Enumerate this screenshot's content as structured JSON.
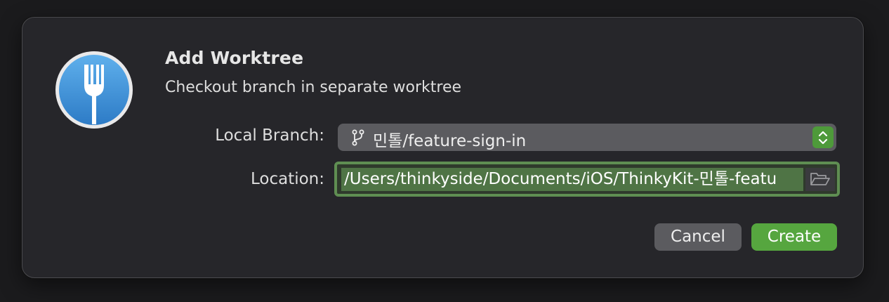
{
  "dialog": {
    "title": "Add Worktree",
    "subtitle": "Checkout branch in separate worktree",
    "app_icon": "fork-icon"
  },
  "form": {
    "branch_label": "Local Branch:",
    "branch_value": "민톨/feature-sign-in",
    "branch_icon": "git-branch-icon",
    "location_label": "Location:",
    "location_value": "/Users/thinkyside/Documents/iOS/ThinkyKit-민톨-featu",
    "folder_icon": "folder-open-icon"
  },
  "buttons": {
    "cancel_label": "Cancel",
    "create_label": "Create"
  },
  "colors": {
    "accent": "#56a63f",
    "dialog_bg": "#26262a",
    "control_bg": "#5b5b5f"
  }
}
